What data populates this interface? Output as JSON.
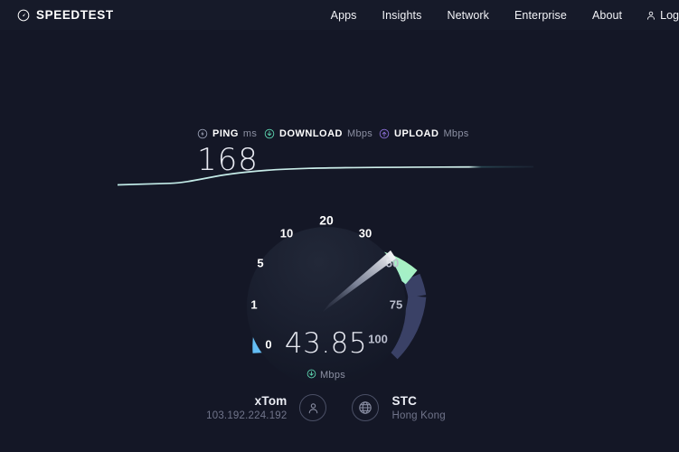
{
  "header": {
    "brand_icon": "speedtest-gauge-icon",
    "brand_text": "SPEEDTEST",
    "nav_items": [
      {
        "label": "Apps",
        "name": "nav-apps"
      },
      {
        "label": "Insights",
        "name": "nav-insights"
      },
      {
        "label": "Network",
        "name": "nav-network"
      },
      {
        "label": "Enterprise",
        "name": "nav-enterprise"
      },
      {
        "label": "About",
        "name": "nav-about"
      }
    ],
    "login": {
      "icon": "person-icon",
      "label": "Log"
    }
  },
  "metrics": [
    {
      "icon": "ping-icon",
      "name": "PING",
      "unit": "ms",
      "value": "168",
      "accent": "#9aa0b5"
    },
    {
      "icon": "download-arrow-icon",
      "name": "DOWNLOAD",
      "unit": "Mbps",
      "value": "",
      "accent": "#5dd6b0"
    },
    {
      "icon": "upload-arrow-icon",
      "name": "UPLOAD",
      "unit": "Mbps",
      "value": "",
      "accent": "#8c6fd6"
    }
  ],
  "gauge": {
    "ticks": [
      "0",
      "1",
      "5",
      "10",
      "20",
      "30",
      "50",
      "75",
      "100"
    ],
    "value": "43.85",
    "unit": "Mbps",
    "unit_icon": "download-arrow-icon",
    "needle_value": 43.85,
    "arc_colors": {
      "start": "#6cc4f5",
      "mid": "#7fe8e0",
      "end": "#a9f2c0",
      "track": "#3a4166"
    }
  },
  "connection": {
    "isp": {
      "icon": "person-icon",
      "name": "xTom",
      "detail": "103.192.224.192"
    },
    "server": {
      "icon": "globe-icon",
      "name": "STC",
      "detail": "Hong Kong"
    }
  },
  "colors": {
    "background": "#141726",
    "header": "#161a29",
    "text": "#ffffff",
    "muted": "#8c90a3"
  }
}
